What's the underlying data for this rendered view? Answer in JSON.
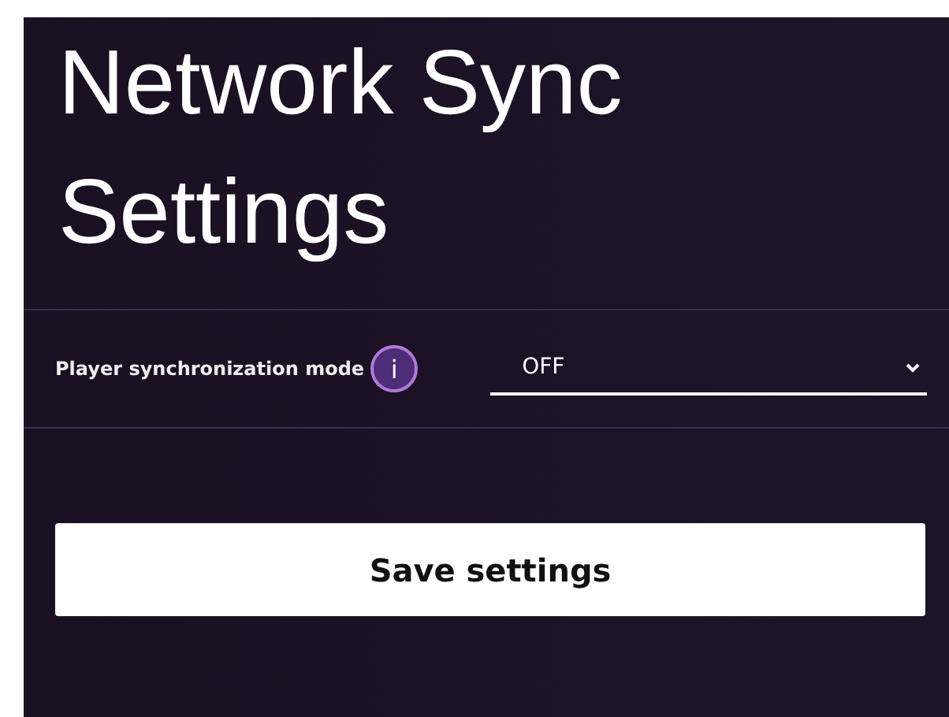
{
  "title": "Network Sync Settings",
  "setting": {
    "label": "Player synchronization mode",
    "info": "i",
    "value": "OFF"
  },
  "save_button": "Save settings"
}
